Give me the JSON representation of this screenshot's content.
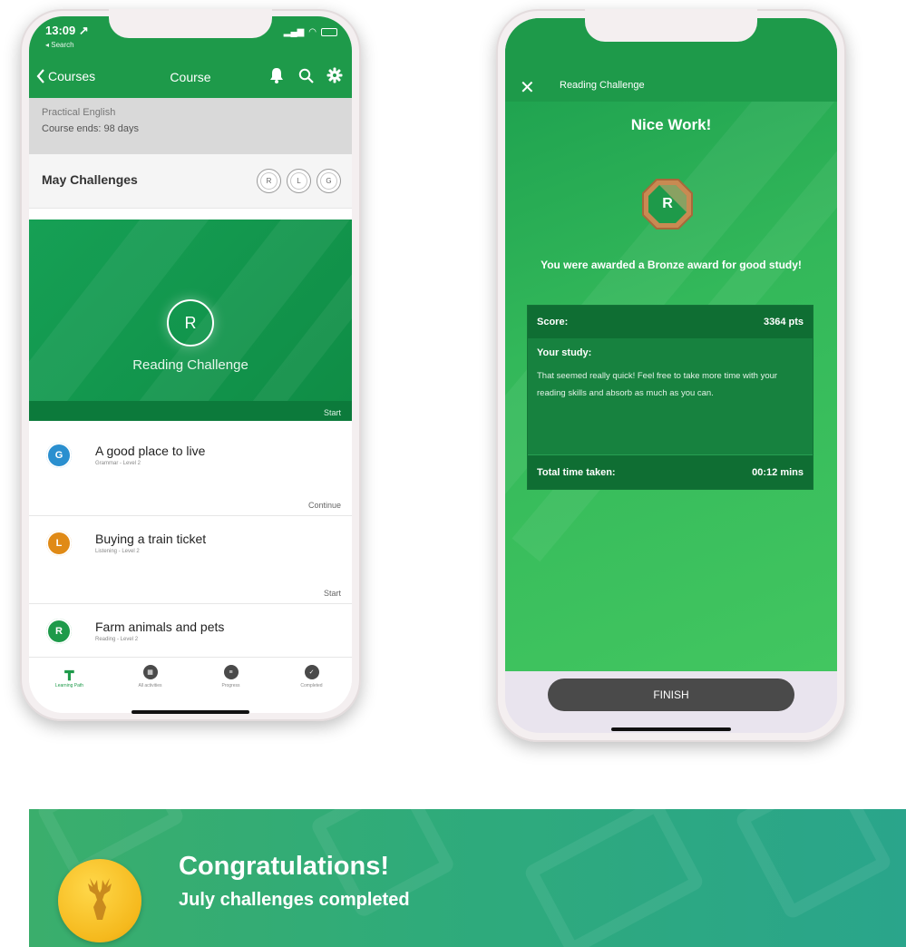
{
  "left_phone": {
    "status": {
      "time": "13:09 ↗",
      "back_app": "◂ Search"
    },
    "nav": {
      "back_label": "Courses",
      "title": "Course"
    },
    "course": {
      "name": "Practical English",
      "ends": "Course ends: 98 days"
    },
    "challenges": {
      "title": "May Challenges",
      "badges": [
        "R",
        "L",
        "G"
      ]
    },
    "hero": {
      "letter": "R",
      "title": "Reading Challenge",
      "action": "Start"
    },
    "activities": [
      {
        "letter": "G",
        "title": "A good place to live",
        "subtitle": "Grammar - Level 2",
        "action": "Continue",
        "color": "#2a8fcf"
      },
      {
        "letter": "L",
        "title": "Buying a train ticket",
        "subtitle": "Listening - Level 2",
        "action": "Start",
        "color": "#e08a16"
      },
      {
        "letter": "R",
        "title": "Farm animals and pets",
        "subtitle": "Reading - Level 2",
        "action": "",
        "color": "#1e9a4a"
      }
    ],
    "tabs": [
      {
        "label": "Learning Path",
        "glyph": "┳",
        "active": true
      },
      {
        "label": "All activities",
        "glyph": "▦",
        "active": false
      },
      {
        "label": "Progress",
        "glyph": "≡",
        "active": false
      },
      {
        "label": "Completed",
        "glyph": "✓",
        "active": false
      }
    ]
  },
  "right_phone": {
    "header_title": "Reading Challenge",
    "headline": "Nice Work!",
    "badge_letter": "R",
    "award_text": "You were awarded a Bronze award for good study!",
    "score_label": "Score:",
    "score_value": "3364 pts",
    "study_label": "Your study:",
    "study_text": "That seemed really quick! Feel free to take more time with your reading skills and absorb as much as you can.",
    "time_label": "Total time taken:",
    "time_value": "00:12 mins",
    "finish_label": "FINISH"
  },
  "banner": {
    "title": "Congratulations!",
    "subtitle": "July challenges completed"
  },
  "colors": {
    "brand_green": "#1e9a4a",
    "bronze": "#c98a52",
    "gold": "#f5b91d",
    "banner_teal": "#2aa58b"
  }
}
